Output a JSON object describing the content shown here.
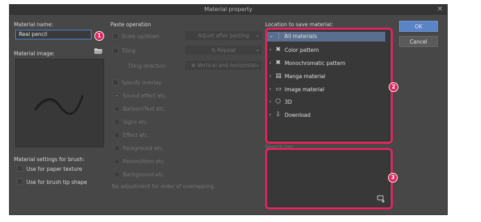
{
  "dialog": {
    "title": "Material property",
    "close_glyph": "✕"
  },
  "name": {
    "label": "Material name:",
    "value": "Real pencil",
    "badge": "1"
  },
  "image": {
    "label": "Material image:"
  },
  "brush_settings": {
    "label": "Material settings for brush:",
    "paper_texture": "Use for paper texture",
    "brush_tip": "Use for brush tip shape"
  },
  "paste": {
    "label": "Paste operation",
    "scale_label": "Scale up/down",
    "scale_value": "Adjust after pasting",
    "tiling_label": "Tiling",
    "tiling_value": "Repeat",
    "tiling_direction_label": "Tiling direction",
    "tiling_direction_value": "Vertical and horizontal",
    "specify_overlay": "Specify overlay",
    "overlay_options": [
      "Sound effect etc.",
      "Balloon/Text etc.",
      "Signs etc.",
      "Effect etc.",
      "Foreground etc.",
      "Person/Item etc.",
      "Background etc."
    ],
    "no_adjustment": "No adjustment for order of overlapping."
  },
  "location": {
    "label": "Location to save material:",
    "badge": "2",
    "items": [
      {
        "label": "All materials",
        "icon": "grid-icon",
        "glyph": "⋮⋮",
        "chev": "⌄"
      },
      {
        "label": "Color pattern",
        "icon": "color-pattern-icon",
        "glyph": "✖",
        "chev": "›"
      },
      {
        "label": "Monochromatic pattern",
        "icon": "monochromatic-pattern-icon",
        "glyph": "✖",
        "chev": "›"
      },
      {
        "label": "Manga material",
        "icon": "manga-material-icon",
        "glyph": "▤",
        "chev": "›"
      },
      {
        "label": "Image material",
        "icon": "image-material-icon",
        "glyph": "▭",
        "chev": "›"
      },
      {
        "label": "3D",
        "icon": "3d-icon",
        "glyph": "⬡",
        "chev": "›"
      },
      {
        "label": "Download",
        "icon": "download-icon",
        "glyph": "⇩",
        "chev": "›"
      }
    ]
  },
  "search_tag": {
    "label": "Search tag:",
    "badge": "3"
  },
  "buttons": {
    "ok": "OK",
    "cancel": "Cancel"
  },
  "colors": {
    "accent": "#5b84c7",
    "highlight": "#e0245e",
    "selection": "#5a6f8f"
  }
}
